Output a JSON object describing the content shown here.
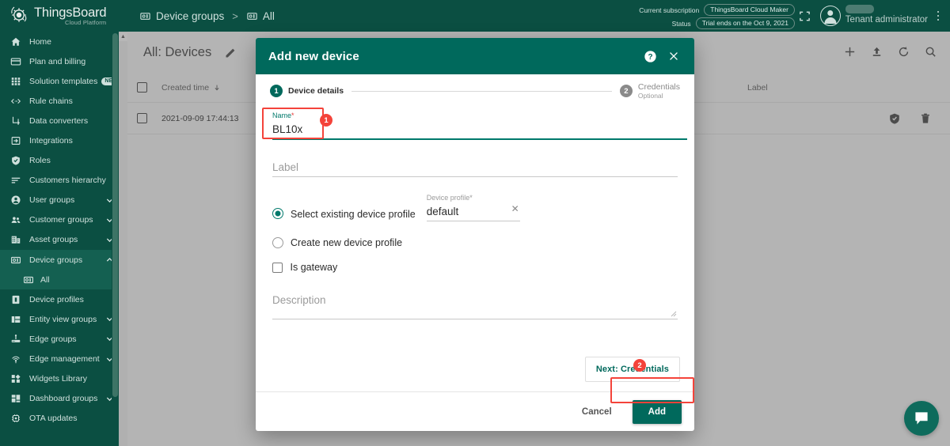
{
  "brand": {
    "name": "ThingsBoard",
    "subtitle": "Cloud Platform"
  },
  "breadcrumb": {
    "items": [
      {
        "label": "Device groups",
        "icon": "device-group-icon"
      },
      {
        "label": "All",
        "icon": "device-group-icon"
      }
    ],
    "separator": ">"
  },
  "subscription": {
    "current_label": "Current subscription",
    "current_value": "ThingsBoard Cloud Maker",
    "status_label": "Status",
    "status_value": "Trial ends on the Oct 9, 2021"
  },
  "user": {
    "name": "Tenant administrator"
  },
  "sidebar": {
    "items": [
      {
        "label": "Home",
        "icon": "home-icon",
        "expandable": false,
        "badge": null,
        "active": false,
        "sub": false
      },
      {
        "label": "Plan and billing",
        "icon": "credit-card-icon",
        "expandable": false,
        "badge": null,
        "active": false,
        "sub": false
      },
      {
        "label": "Solution templates",
        "icon": "grid-icon",
        "expandable": false,
        "badge": "NEW",
        "active": false,
        "sub": false
      },
      {
        "label": "Rule chains",
        "icon": "rule-chain-icon",
        "expandable": false,
        "badge": null,
        "active": false,
        "sub": false
      },
      {
        "label": "Data converters",
        "icon": "data-converter-icon",
        "expandable": false,
        "badge": null,
        "active": false,
        "sub": false
      },
      {
        "label": "Integrations",
        "icon": "integration-icon",
        "expandable": false,
        "badge": null,
        "active": false,
        "sub": false
      },
      {
        "label": "Roles",
        "icon": "shield-icon",
        "expandable": false,
        "badge": null,
        "active": false,
        "sub": false
      },
      {
        "label": "Customers hierarchy",
        "icon": "hierarchy-icon",
        "expandable": false,
        "badge": null,
        "active": false,
        "sub": false
      },
      {
        "label": "User groups",
        "icon": "user-icon",
        "expandable": true,
        "badge": null,
        "active": false,
        "sub": false
      },
      {
        "label": "Customer groups",
        "icon": "users-icon",
        "expandable": true,
        "badge": null,
        "active": false,
        "sub": false
      },
      {
        "label": "Asset groups",
        "icon": "building-icon",
        "expandable": true,
        "badge": null,
        "active": false,
        "sub": false
      },
      {
        "label": "Device groups",
        "icon": "device-group-icon",
        "expandable": true,
        "badge": null,
        "active": true,
        "sub": false,
        "expanded": true
      },
      {
        "label": "All",
        "icon": "device-group-icon",
        "expandable": false,
        "badge": null,
        "active": true,
        "sub": true
      },
      {
        "label": "Device profiles",
        "icon": "device-profile-icon",
        "expandable": false,
        "badge": null,
        "active": false,
        "sub": false
      },
      {
        "label": "Entity view groups",
        "icon": "entity-view-icon",
        "expandable": true,
        "badge": null,
        "active": false,
        "sub": false
      },
      {
        "label": "Edge groups",
        "icon": "edge-icon",
        "expandable": true,
        "badge": null,
        "active": false,
        "sub": false
      },
      {
        "label": "Edge management",
        "icon": "edge-management-icon",
        "expandable": true,
        "badge": null,
        "active": false,
        "sub": false
      },
      {
        "label": "Widgets Library",
        "icon": "widgets-icon",
        "expandable": false,
        "badge": null,
        "active": false,
        "sub": false
      },
      {
        "label": "Dashboard groups",
        "icon": "dashboard-icon",
        "expandable": true,
        "badge": null,
        "active": false,
        "sub": false
      },
      {
        "label": "OTA updates",
        "icon": "ota-icon",
        "expandable": false,
        "badge": null,
        "active": false,
        "sub": false
      }
    ]
  },
  "main": {
    "page_title": "All: Devices",
    "toolbar_icons": [
      "plus-icon",
      "upload-icon",
      "refresh-icon",
      "search-icon"
    ],
    "table": {
      "columns": [
        {
          "key": "created_time",
          "label": "Created time",
          "sorted": true,
          "sort_dir": "down"
        },
        {
          "key": "label",
          "label": "Label"
        }
      ],
      "rows": [
        {
          "created_time": "2021-09-09 17:44:13",
          "label": "",
          "actions": [
            "shield-icon",
            "delete-icon"
          ]
        }
      ]
    }
  },
  "dialog": {
    "title": "Add new device",
    "header_icons": [
      "help-icon",
      "close-icon"
    ],
    "steps": [
      {
        "number": "1",
        "label": "Device details",
        "sub": "",
        "active": true
      },
      {
        "number": "2",
        "label": "Credentials",
        "sub": "Optional",
        "active": false
      }
    ],
    "fields": {
      "name": {
        "label": "Name",
        "required_mark": "*",
        "value": "BL10x",
        "placeholder": ""
      },
      "label": {
        "label": "",
        "value": "",
        "placeholder": "Label"
      },
      "device_profile": {
        "label": "Device profile",
        "required_mark": "*",
        "value": "default",
        "clear_icon": "close-icon"
      },
      "description": {
        "label": "",
        "value": "",
        "placeholder": "Description"
      }
    },
    "radios": [
      {
        "label": "Select existing device profile",
        "checked": true
      },
      {
        "label": "Create new device profile",
        "checked": false
      }
    ],
    "checkbox": {
      "label": "Is gateway",
      "checked": false
    },
    "next_button": "Next: Credentials",
    "cancel_button": "Cancel",
    "add_button": "Add"
  },
  "annotations": [
    {
      "id": "1",
      "target": "name-field"
    },
    {
      "id": "2",
      "target": "next-credentials-button"
    }
  ],
  "chat": {
    "icon": "chat-icon"
  },
  "colors": {
    "brand_dark": "#0b4f42",
    "dialog_header": "#00695c",
    "accent": "#00796b",
    "annotation_red": "#f4433a",
    "page_bg": "#b4b4b4"
  }
}
